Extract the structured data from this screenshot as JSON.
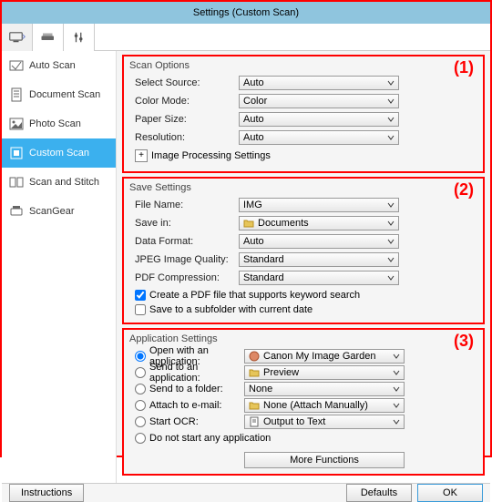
{
  "window": {
    "title": "Settings (Custom Scan)"
  },
  "tabs": {
    "scanner": "scanner",
    "feeder": "feeder",
    "tools": "tools"
  },
  "sidebar": {
    "items": [
      {
        "label": "Auto Scan"
      },
      {
        "label": "Document Scan"
      },
      {
        "label": "Photo Scan"
      },
      {
        "label": "Custom Scan"
      },
      {
        "label": "Scan and Stitch"
      },
      {
        "label": "ScanGear"
      }
    ]
  },
  "annotations": {
    "g1": "(1)",
    "g2": "(2)",
    "g3": "(3)"
  },
  "scan_options": {
    "title": "Scan Options",
    "select_source": {
      "label": "Select Source:",
      "value": "Auto"
    },
    "color_mode": {
      "label": "Color Mode:",
      "value": "Color"
    },
    "paper_size": {
      "label": "Paper Size:",
      "value": "Auto"
    },
    "resolution": {
      "label": "Resolution:",
      "value": "Auto"
    },
    "image_processing": {
      "label": "Image Processing Settings",
      "expand": "+"
    }
  },
  "save_settings": {
    "title": "Save Settings",
    "file_name": {
      "label": "File Name:",
      "value": "IMG"
    },
    "save_in": {
      "label": "Save in:",
      "value": "Documents"
    },
    "data_format": {
      "label": "Data Format:",
      "value": "Auto"
    },
    "jpeg": {
      "label": "JPEG Image Quality:",
      "value": "Standard"
    },
    "pdf": {
      "label": "PDF Compression:",
      "value": "Standard"
    },
    "chk_pdf": {
      "label": "Create a PDF file that supports keyword search",
      "checked": true
    },
    "chk_subfolder": {
      "label": "Save to a subfolder with current date",
      "checked": false
    }
  },
  "app_settings": {
    "title": "Application Settings",
    "open_app": {
      "label": "Open with an application:",
      "value": "Canon My Image Garden"
    },
    "send_app": {
      "label": "Send to an application:",
      "value": "Preview"
    },
    "send_folder": {
      "label": "Send to a folder:",
      "value": "None"
    },
    "attach": {
      "label": "Attach to e-mail:",
      "value": "None (Attach Manually)"
    },
    "ocr": {
      "label": "Start OCR:",
      "value": "Output to Text"
    },
    "nostart": {
      "label": "Do not start any application"
    },
    "selected": "open_app",
    "more": "More Functions"
  },
  "buttons": {
    "instructions": "Instructions",
    "defaults": "Defaults",
    "ok": "OK"
  }
}
